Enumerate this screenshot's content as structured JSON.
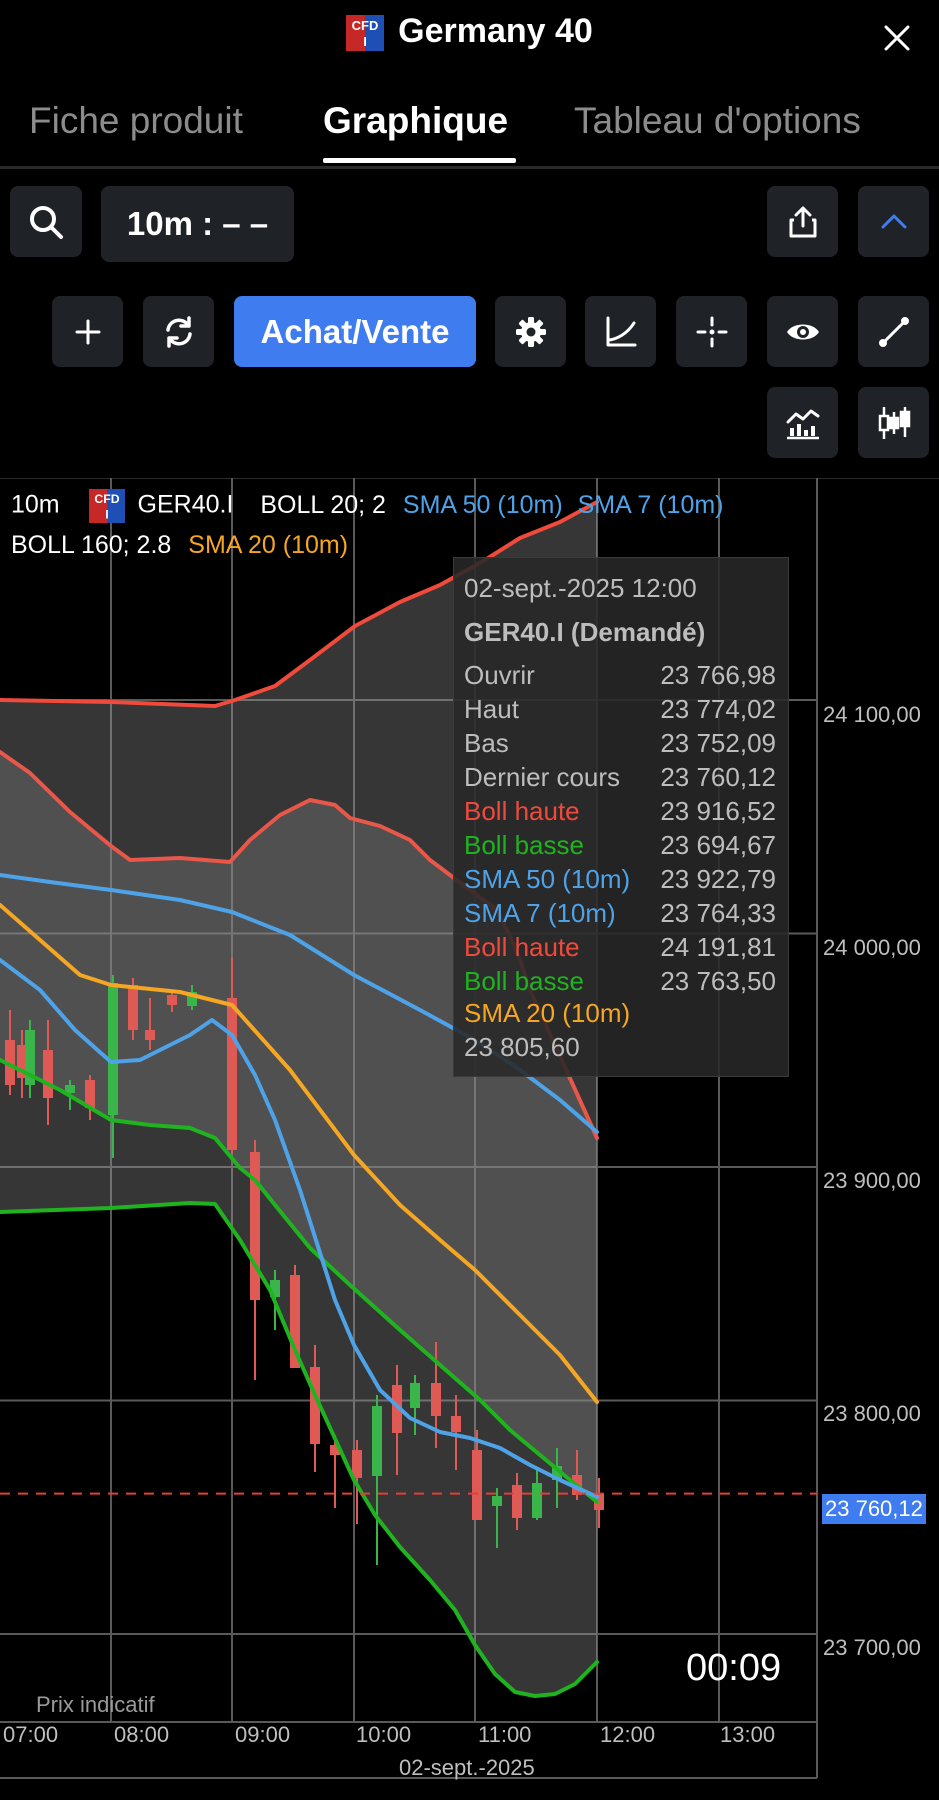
{
  "header": {
    "title": "Germany 40",
    "cfd_badge": "CFD",
    "cfd_badge_sub": "I"
  },
  "tabs": [
    {
      "label": "Fiche produit",
      "active": false
    },
    {
      "label": "Graphique",
      "active": true
    },
    {
      "label": "Tableau d'options",
      "active": false
    }
  ],
  "toolbar": {
    "timeframe_label": "10m : – –",
    "trade_label": "Achat/Vente"
  },
  "legend": {
    "interval": "10m",
    "symbol": "GER40.I",
    "boll1": "BOLL 20; 2",
    "sma50": "SMA 50 (10m)",
    "sma7": "SMA 7 (10m)",
    "boll2": "BOLL 160; 2.8",
    "sma20": "SMA 20 (10m)"
  },
  "tooltip": {
    "datetime": "02-sept.-2025 12:00",
    "instrument": "GER40.I (Demandé)",
    "rows": [
      {
        "label": "Ouvrir",
        "value": "23 766,98",
        "color": "#bdbdbd"
      },
      {
        "label": "Haut",
        "value": "23 774,02",
        "color": "#bdbdbd"
      },
      {
        "label": "Bas",
        "value": "23 752,09",
        "color": "#bdbdbd"
      },
      {
        "label": "Dernier cours",
        "value": "23 760,12",
        "color": "#bdbdbd"
      },
      {
        "label": "Boll haute",
        "value": "23 916,52",
        "color": "#ef4a3c"
      },
      {
        "label": "Boll basse",
        "value": "23 694,67",
        "color": "#1fb31f"
      },
      {
        "label": "SMA 50 (10m)",
        "value": "23 922,79",
        "color": "#4ea3e8"
      },
      {
        "label": "SMA 7 (10m)",
        "value": "23 764,33",
        "color": "#4ea3e8"
      },
      {
        "label": "Boll haute",
        "value": "24 191,81",
        "color": "#ef4a3c"
      },
      {
        "label": "Boll basse",
        "value": "23 763,50",
        "color": "#1fb31f"
      }
    ],
    "sma20_label": "SMA 20 (10m)",
    "sma20_value": "23 805,60"
  },
  "price_axis": {
    "ticks": [
      "24 100,00",
      "24 000,00",
      "23 900,00",
      "23 800,00",
      "23 700,00"
    ],
    "current_price": "23 760,12"
  },
  "time_axis": {
    "ticks": [
      "07:00",
      "08:00",
      "09:00",
      "10:00",
      "11:00",
      "12:00",
      "13:00"
    ],
    "date": "02-sept.-2025"
  },
  "chart_overlay": {
    "countdown": "00:09",
    "indicative_label": "Prix indicatif"
  },
  "colors": {
    "accent": "#3f7cf0",
    "boll_upper": "#ef4a3c",
    "boll_lower": "#1fb31f",
    "sma_blue": "#4ea3e8",
    "sma20": "#f5a623",
    "candle_up": "#3ab54a",
    "candle_down": "#e05a55",
    "current_price_bg": "#3f7cf0"
  },
  "icons": [
    "search-icon",
    "share-icon",
    "chevron-up-icon",
    "plus-icon",
    "refresh-icon",
    "gear-icon",
    "curve-icon",
    "crosshair-icon",
    "eye-icon",
    "draw-line-icon",
    "indicators-icon",
    "candles-icon",
    "close-icon"
  ],
  "chart_data": {
    "type": "candlestick",
    "x": [
      "07:00",
      "08:00",
      "09:00",
      "10:00",
      "11:00",
      "12:00",
      "13:00"
    ],
    "ylim": [
      23680,
      24180
    ],
    "current_price": 23760.12
  }
}
